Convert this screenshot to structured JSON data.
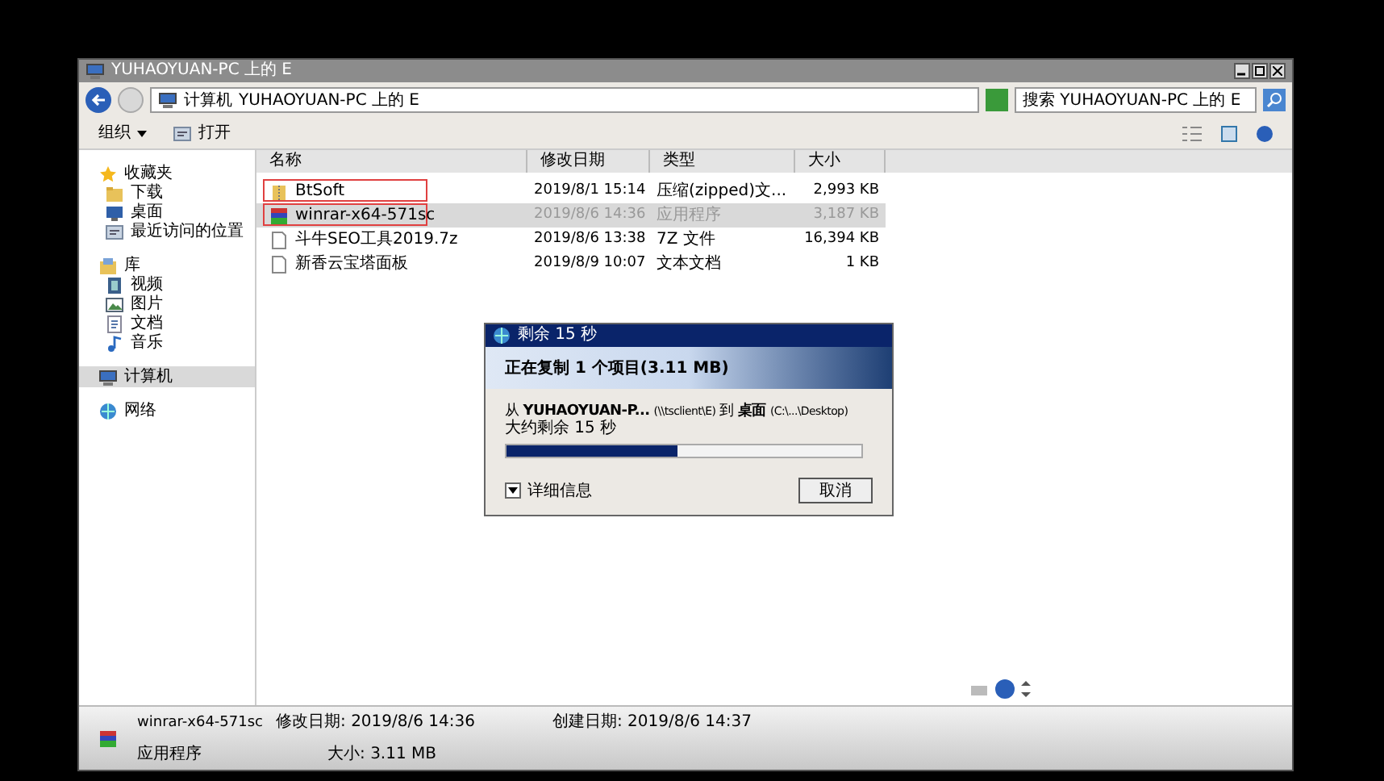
{
  "window": {
    "title": "YUHAOYUAN-PC 上的 E"
  },
  "address": {
    "crumbs": [
      "计算机",
      "YUHAOYUAN-PC 上的 E"
    ],
    "search_placeholder": "搜索 YUHAOYUAN-PC 上的 E"
  },
  "toolbar": {
    "organize": "组织",
    "open": "打开"
  },
  "sidebar": [
    {
      "label": "收藏夹",
      "selected": false,
      "children": [
        {
          "label": "下载",
          "selected": false
        },
        {
          "label": "桌面",
          "selected": false
        },
        {
          "label": "最近访问的位置",
          "selected": false
        }
      ]
    },
    {
      "label": "库",
      "selected": false,
      "children": [
        {
          "label": "视频",
          "selected": false
        },
        {
          "label": "图片",
          "selected": false
        },
        {
          "label": "文档",
          "selected": false
        },
        {
          "label": "音乐",
          "selected": false
        }
      ]
    },
    {
      "label": "计算机",
      "selected": true
    },
    {
      "label": "网络",
      "selected": false
    }
  ],
  "table": {
    "columns": [
      "名称",
      "修改日期",
      "类型",
      "大小"
    ],
    "rows": [
      {
        "name": "BtSoft",
        "date": "2019/8/1 15:14",
        "type": "压缩(zipped)文...",
        "size": "2,993 KB",
        "selected": false,
        "marked": true
      },
      {
        "name": "winrar-x64-571sc",
        "date": "2019/8/6 14:36",
        "type": "应用程序",
        "size": "3,187 KB",
        "selected": true,
        "marked": true
      },
      {
        "name": "斗牛SEO工具2019.7z",
        "date": "2019/8/6 13:38",
        "type": "7Z 文件",
        "size": "16,394 KB",
        "selected": false,
        "marked": false
      },
      {
        "name": "新香云宝塔面板",
        "date": "2019/8/9 10:07",
        "type": "文本文档",
        "size": "1 KB",
        "selected": false,
        "marked": false
      }
    ]
  },
  "dialog": {
    "title": "剩余 15 秒",
    "heading": "正在复制 1 个项目(3.11 MB)",
    "from_label": "从",
    "from_name": "YUHAOYUAN-P...",
    "from_path": "(\\\\tsclient\\E)",
    "to_label": "到",
    "to_name": "桌面",
    "to_path": "(C:\\...\\Desktop)",
    "remaining": "大约剩余 15 秒",
    "level": 0.48,
    "details": "详细信息",
    "cancel": "取消"
  },
  "details_pane": {
    "name": "winrar-x64-571sc",
    "type": "应用程序",
    "modified_label": "修改日期:",
    "modified": "2019/8/6 14:36",
    "size_label": "大小:",
    "size": "3.11 MB",
    "created_label": "创建日期:",
    "created": "2019/8/6 14:37"
  }
}
